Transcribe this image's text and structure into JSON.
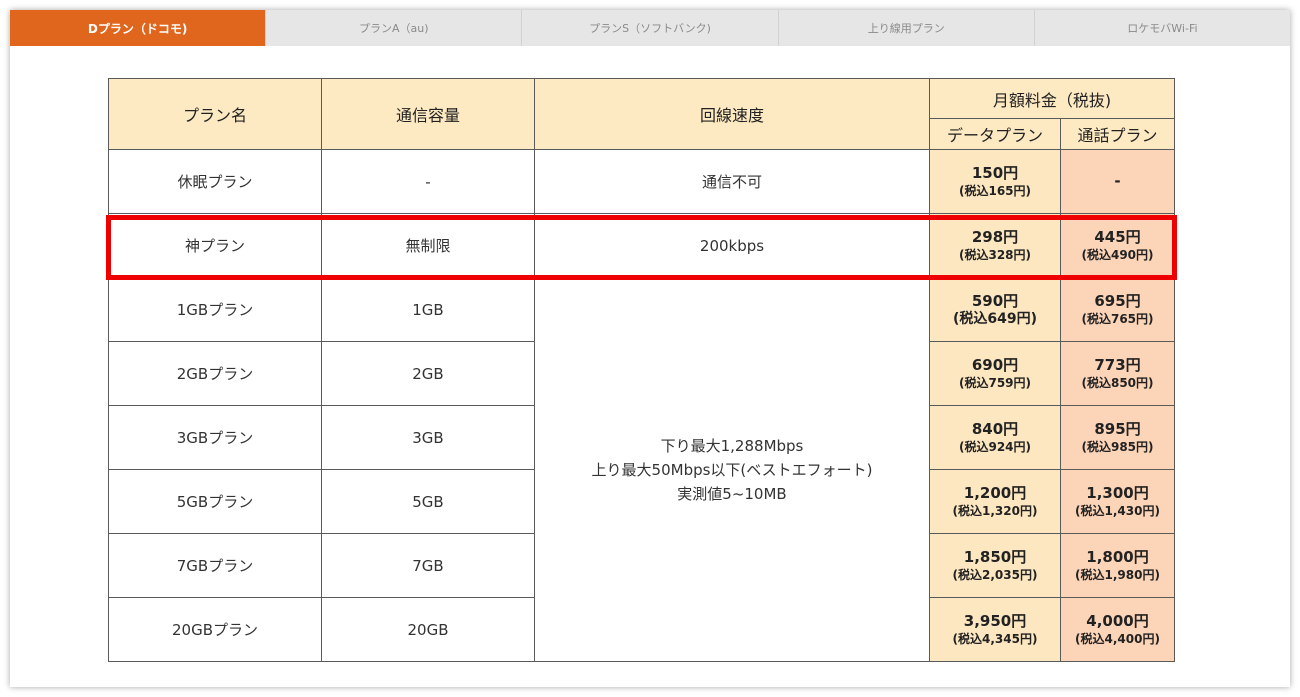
{
  "tabs": [
    {
      "label": "Dプラン（ドコモ)"
    },
    {
      "label": "プランA（au)"
    },
    {
      "label": "プランS（ソフトバンク)"
    },
    {
      "label": "上り線用プラン"
    },
    {
      "label": "ロケモバWi-Fi"
    }
  ],
  "table": {
    "headers": {
      "plan": "プラン名",
      "capacity": "通信容量",
      "speed": "回線速度",
      "monthly_fee": "月額料金（税抜)",
      "data_plan": "データプラン",
      "call_plan": "通話プラン"
    },
    "rows": [
      {
        "name": "休眠プラン",
        "capacity": "-",
        "speed": "通信不可",
        "data_price": "150円",
        "data_tax": "(税込165円)",
        "call_price": "-",
        "call_tax": ""
      },
      {
        "name": "神プラン",
        "capacity": "無制限",
        "speed": "200kbps",
        "data_price": "298円",
        "data_tax": "(税込328円)",
        "call_price": "445円",
        "call_tax": "(税込490円)"
      },
      {
        "name": "1GBプラン",
        "capacity": "1GB",
        "data_price": "590円",
        "data_tax": "(税込649円)",
        "call_price": "695円",
        "call_tax": "(税込765円)"
      },
      {
        "name": "2GBプラン",
        "capacity": "2GB",
        "data_price": "690円",
        "data_tax": "(税込759円)",
        "call_price": "773円",
        "call_tax": "(税込850円)"
      },
      {
        "name": "3GBプラン",
        "capacity": "3GB",
        "data_price": "840円",
        "data_tax": "(税込924円)",
        "call_price": "895円",
        "call_tax": "(税込985円)"
      },
      {
        "name": "5GBプラン",
        "capacity": "5GB",
        "data_price": "1,200円",
        "data_tax": "(税込1,320円)",
        "call_price": "1,300円",
        "call_tax": "(税込1,430円)"
      },
      {
        "name": "7GBプラン",
        "capacity": "7GB",
        "data_price": "1,850円",
        "data_tax": "(税込2,035円)",
        "call_price": "1,800円",
        "call_tax": "(税込1,980円)"
      },
      {
        "name": "20GBプラン",
        "capacity": "20GB",
        "data_price": "3,950円",
        "data_tax": "(税込4,345円)",
        "call_price": "4,000円",
        "call_tax": "(税込4,400円)"
      }
    ],
    "shared_speed": [
      "下り最大1,288Mbps",
      "上り最大50Mbps以下(ベストエフォート)",
      "実測値5~10MB"
    ]
  },
  "colors": {
    "active_tab": "#e0651d",
    "header_bg": "#fde9c2",
    "data_price_bg": "#fde7c0",
    "call_price_bg": "#fcd4b7",
    "highlight_border": "#ee0000"
  }
}
